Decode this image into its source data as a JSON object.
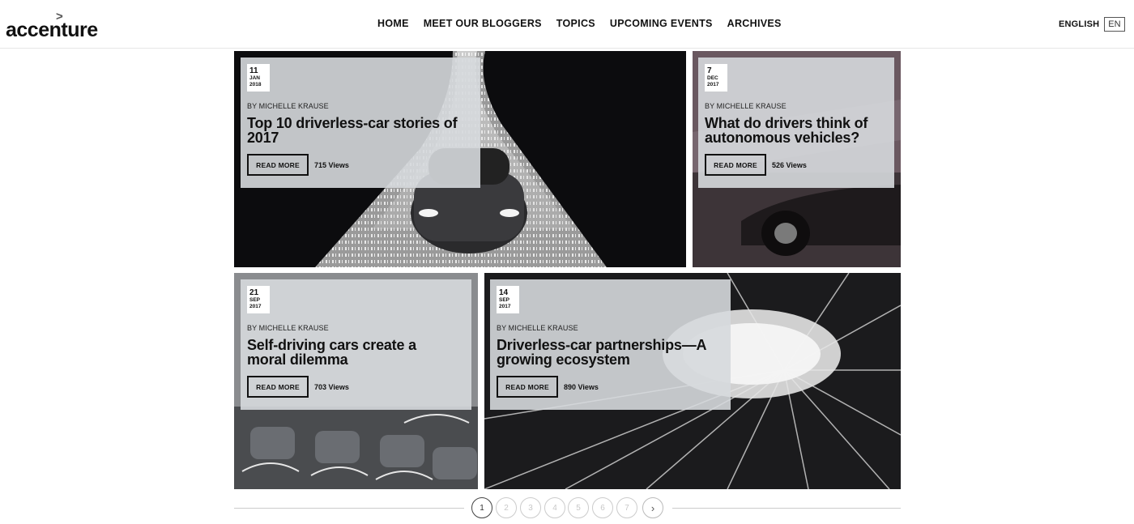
{
  "brand": {
    "logo_text": "accenture",
    "logo_arrow": ">"
  },
  "nav": {
    "items": [
      {
        "label": "HOME"
      },
      {
        "label": "MEET OUR BLOGGERS"
      },
      {
        "label": "TOPICS"
      },
      {
        "label": "UPCOMING EVENTS"
      },
      {
        "label": "ARCHIVES"
      }
    ]
  },
  "language": {
    "label": "ENGLISH",
    "code": "EN"
  },
  "posts": [
    {
      "day": "11",
      "month": "JAN",
      "year": "2018",
      "byline": "BY MICHELLE KRAUSE",
      "title": "Top 10 driverless-car stories of 2017",
      "read_more": "READ MORE",
      "views": "715 Views"
    },
    {
      "day": "7",
      "month": "DEC",
      "year": "2017",
      "byline": "BY MICHELLE KRAUSE",
      "title": "What do drivers think of autonomous vehicles?",
      "read_more": "READ MORE",
      "views": "526 Views"
    },
    {
      "day": "21",
      "month": "SEP",
      "year": "2017",
      "byline": "BY MICHELLE KRAUSE",
      "title": "Self-driving cars create a moral dilemma",
      "read_more": "READ MORE",
      "views": "703 Views"
    },
    {
      "day": "14",
      "month": "SEP",
      "year": "2017",
      "byline": "BY MICHELLE KRAUSE",
      "title": "Driverless-car partnerships—A growing ecosystem",
      "read_more": "READ MORE",
      "views": "890 Views"
    }
  ],
  "pagination": {
    "pages": [
      "1",
      "2",
      "3",
      "4",
      "5",
      "6",
      "7"
    ],
    "current": "1",
    "next_symbol": "›"
  }
}
